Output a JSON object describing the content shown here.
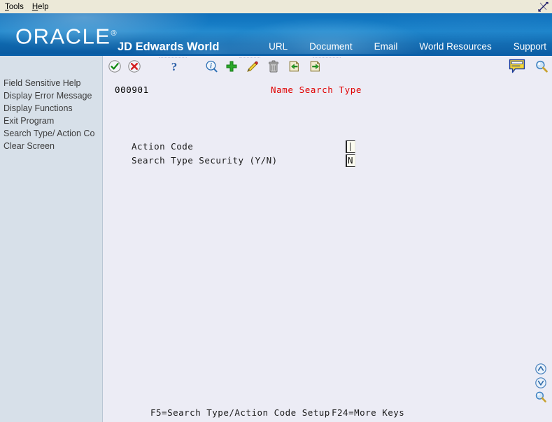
{
  "menubar": {
    "items": [
      {
        "label": "Tools",
        "mnemonic": "T"
      },
      {
        "label": "Help",
        "mnemonic": "H"
      }
    ],
    "corner_icon": "resize-arrows-icon"
  },
  "banner": {
    "logo_text": "ORACLE",
    "logo_tm": "®",
    "product_name": "JD Edwards World",
    "nav": [
      {
        "label": "URL"
      },
      {
        "label": "Document"
      },
      {
        "label": "Email"
      },
      {
        "label": "World Resources"
      },
      {
        "label": "Support"
      }
    ],
    "colors": {
      "blue_dark": "#0a59a0",
      "blue_mid": "#1378c2",
      "blue_light": "#1d86cc"
    }
  },
  "sidebar": {
    "items": [
      {
        "label": "Field Sensitive Help"
      },
      {
        "label": "Display Error Message"
      },
      {
        "label": "Display Functions"
      },
      {
        "label": "Exit Program"
      },
      {
        "label": "Search Type/ Action Co"
      },
      {
        "label": "Clear Screen"
      }
    ],
    "background": "#d7e0e9"
  },
  "toolbar": {
    "icons": [
      {
        "name": "ok-check-icon",
        "title": "OK"
      },
      {
        "name": "cancel-x-icon",
        "title": "Cancel"
      },
      {
        "name": "help-question-icon",
        "title": "Help"
      },
      {
        "name": "info-find-icon",
        "title": "Info"
      },
      {
        "name": "add-plus-icon",
        "title": "Add"
      },
      {
        "name": "edit-pencil-icon",
        "title": "Change"
      },
      {
        "name": "delete-trash-icon",
        "title": "Delete"
      },
      {
        "name": "previous-record-icon",
        "title": "Previous"
      },
      {
        "name": "next-record-icon",
        "title": "Next"
      },
      {
        "name": "note-bubble-icon",
        "title": "Notes"
      },
      {
        "name": "search-magnifier-icon",
        "title": "Search"
      }
    ]
  },
  "screen": {
    "screen_id": "000901",
    "title": "Name Search Type",
    "title_color": "#e00000",
    "fields": [
      {
        "label": "Action Code",
        "value": "",
        "caret": true
      },
      {
        "label": "Search Type Security (Y/N)",
        "value": "N",
        "caret": false
      }
    ],
    "function_keys": [
      {
        "label": "F5=Search Type/Action Code Setup"
      },
      {
        "label": "F24=More Keys"
      }
    ]
  },
  "edge_nav": {
    "icons": [
      {
        "name": "page-up-icon"
      },
      {
        "name": "page-down-icon"
      },
      {
        "name": "find-magnifier-icon"
      }
    ]
  }
}
